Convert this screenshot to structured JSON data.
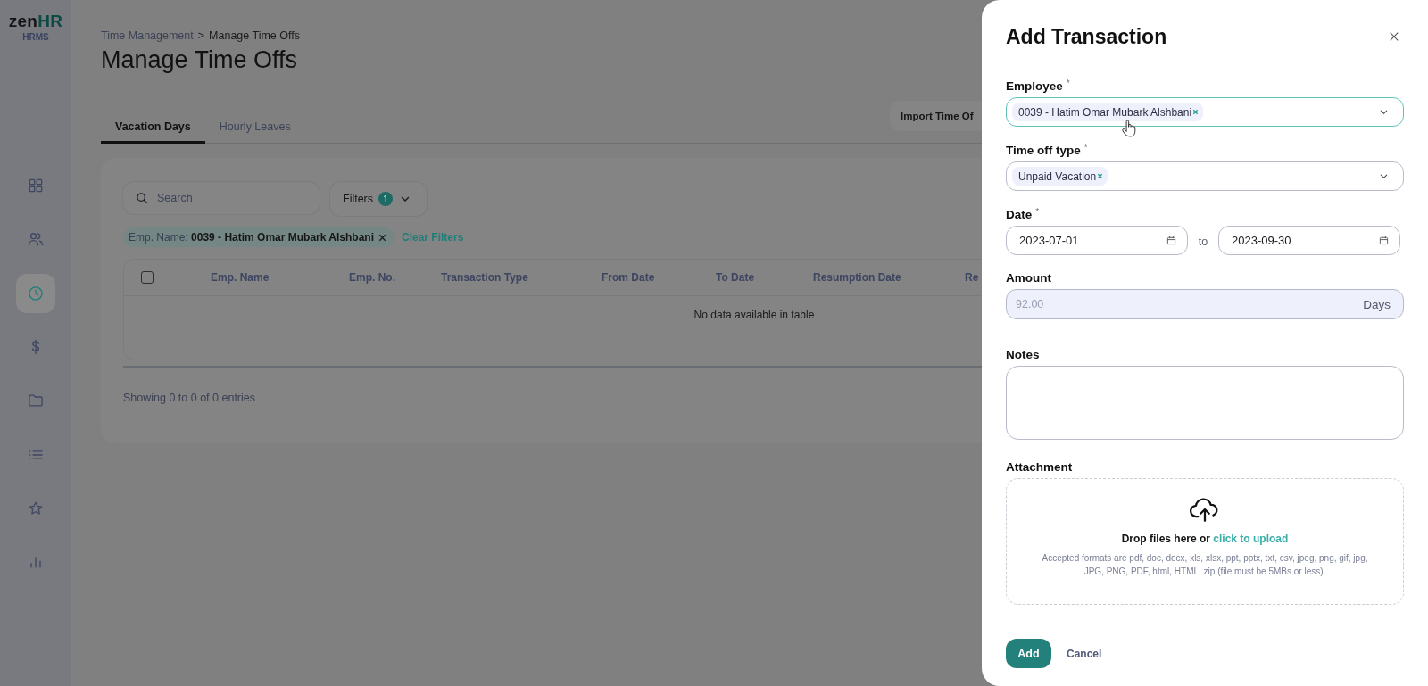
{
  "logo": {
    "text": "zen",
    "accent": "HR",
    "subtitle": "HRMS"
  },
  "sidebar": {
    "items": [
      {
        "kind": "grid",
        "selected": false
      },
      {
        "kind": "people",
        "selected": false
      },
      {
        "kind": "clock",
        "selected": true
      },
      {
        "kind": "dollar",
        "selected": false
      },
      {
        "kind": "folder",
        "selected": false
      },
      {
        "kind": "list",
        "selected": false
      },
      {
        "kind": "star",
        "selected": false
      },
      {
        "kind": "chart",
        "selected": false
      }
    ]
  },
  "breadcrumb": {
    "items": [
      "Time Management",
      "Manage Time Offs"
    ],
    "separator": ">"
  },
  "page_title": "Manage Time Offs",
  "import_button": "Import Time Of",
  "tabs": [
    {
      "label": "Vacation Days",
      "selected": true
    },
    {
      "label": "Hourly Leaves",
      "selected": false
    }
  ],
  "search": {
    "placeholder": "Search"
  },
  "filters": {
    "label": "Filters",
    "count": "1"
  },
  "active_filter": {
    "label": "Emp. Name:",
    "value": "0039 - Hatim Omar Mubark Alshbani"
  },
  "clear_filters": "Clear Filters",
  "table": {
    "select_all_checked": false,
    "columns": [
      "Emp. Name",
      "Emp. No.",
      "Transaction Type",
      "From Date",
      "To Date",
      "Resumption Date",
      "Re"
    ],
    "empty_message": "No data available in table"
  },
  "table_info": "Showing 0 to 0 of 0 entries",
  "drawer": {
    "title": "Add Transaction",
    "employee": {
      "label": "Employee",
      "required_mark": "*",
      "focused": true,
      "tags": [
        "0039 - Hatim Omar Mubark Alshbani"
      ]
    },
    "time_off_type": {
      "label": "Time off type",
      "required_mark": "*",
      "focused": false,
      "tags": [
        "Unpaid Vacation"
      ]
    },
    "date": {
      "label": "Date",
      "required_mark": "*",
      "from": "2023-07-01",
      "separator": "to",
      "to": "2023-09-30"
    },
    "amount": {
      "label": "Amount",
      "value": "92.00",
      "unit": "Days",
      "disabled": true
    },
    "notes": {
      "label": "Notes"
    },
    "attachment": {
      "label": "Attachment",
      "prompt": "Drop files here or",
      "link": "click to upload",
      "hint": "Accepted formats are pdf, doc, docx, xls, xlsx, ppt, pptx, txt, csv, jpeg, png, gif, jpg, JPG, PNG, PDF, html, HTML, zip (file must be 5MBs or less)."
    },
    "buttons": {
      "primary": "Add",
      "secondary": "Cancel"
    }
  }
}
